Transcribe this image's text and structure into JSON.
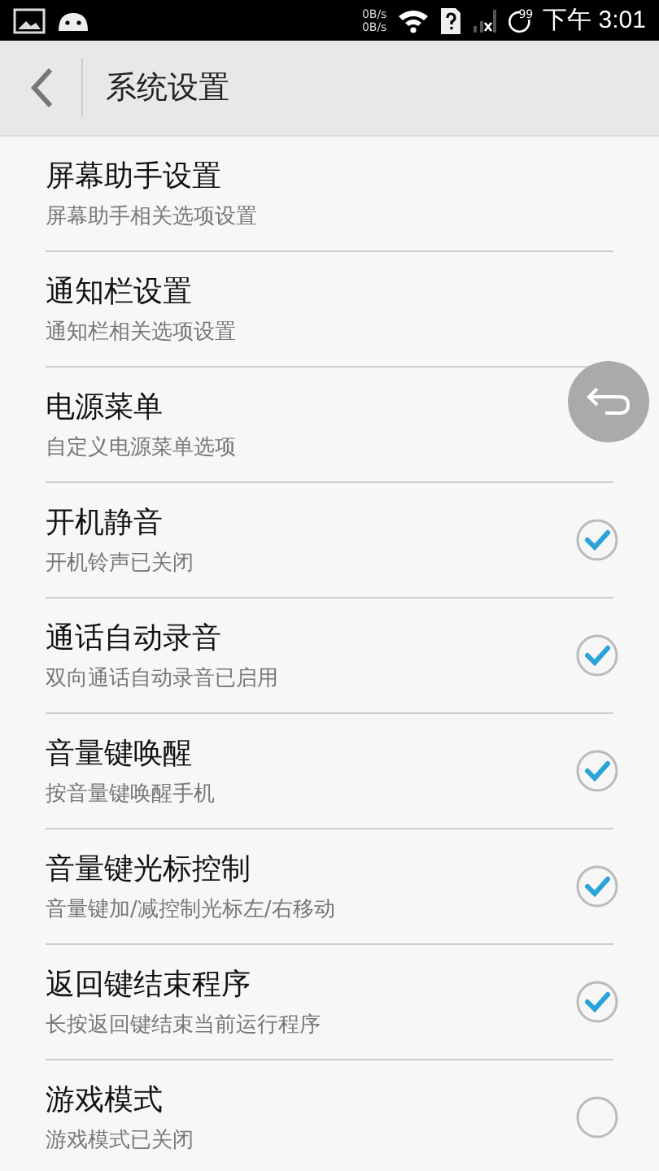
{
  "status_bar": {
    "speed_up": "0B/s",
    "speed_down": "0B/s",
    "battery": "99",
    "time": "下午 3:01"
  },
  "header": {
    "title": "系统设置"
  },
  "settings": [
    {
      "kind": "link",
      "title": "屏幕助手设置",
      "subtitle": "屏幕助手相关选项设置"
    },
    {
      "kind": "link",
      "title": "通知栏设置",
      "subtitle": "通知栏相关选项设置"
    },
    {
      "kind": "link",
      "title": "电源菜单",
      "subtitle": "自定义电源菜单选项"
    },
    {
      "kind": "toggle",
      "title": "开机静音",
      "subtitle": "开机铃声已关闭",
      "checked": true
    },
    {
      "kind": "toggle",
      "title": "通话自动录音",
      "subtitle": "双向通话自动录音已启用",
      "checked": true
    },
    {
      "kind": "toggle",
      "title": "音量键唤醒",
      "subtitle": "按音量键唤醒手机",
      "checked": true
    },
    {
      "kind": "toggle",
      "title": "音量键光标控制",
      "subtitle": "音量键加/减控制光标左/右移动",
      "checked": true
    },
    {
      "kind": "toggle",
      "title": "返回键结束程序",
      "subtitle": "长按返回键结束当前运行程序",
      "checked": true
    },
    {
      "kind": "toggle",
      "title": "游戏模式",
      "subtitle": "游戏模式已关闭",
      "checked": false
    }
  ]
}
